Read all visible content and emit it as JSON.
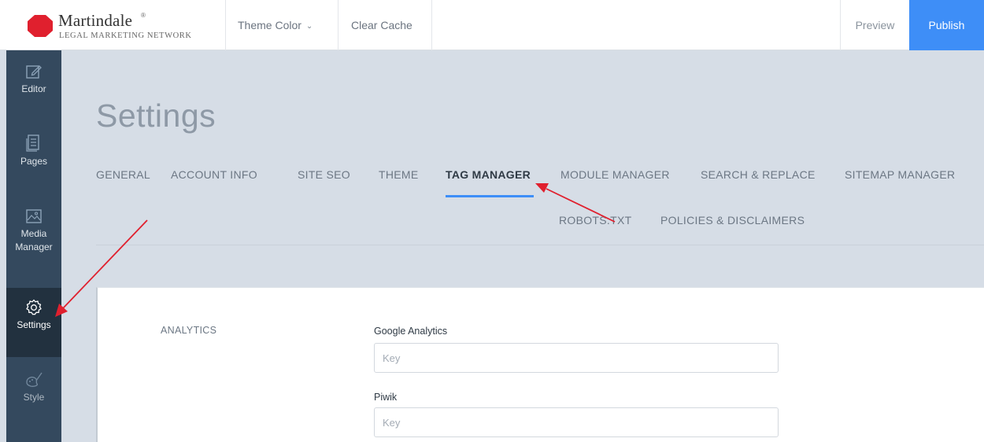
{
  "brand": {
    "name": "Martindale",
    "registered": "®",
    "tagline": "LEGAL MARKETING NETWORK"
  },
  "topbar": {
    "theme_color_label": "Theme Color",
    "clear_cache_label": "Clear Cache",
    "preview_label": "Preview",
    "publish_label": "Publish"
  },
  "sidebar": {
    "items": [
      {
        "label": "Editor",
        "icon": "edit-icon"
      },
      {
        "label": "Pages",
        "icon": "pages-icon"
      },
      {
        "label": "Media",
        "label2": "Manager",
        "icon": "image-icon"
      },
      {
        "label": "Settings",
        "icon": "gear-icon",
        "active": true
      },
      {
        "label": "Style",
        "icon": "palette-icon"
      }
    ]
  },
  "page": {
    "title": "Settings"
  },
  "tabs": [
    {
      "label": "GENERAL"
    },
    {
      "label": "ACCOUNT INFO"
    },
    {
      "label": "SITE SEO"
    },
    {
      "label": "THEME"
    },
    {
      "label": "TAG MANAGER",
      "active": true
    },
    {
      "label": "MODULE MANAGER"
    },
    {
      "label": "SEARCH & REPLACE"
    },
    {
      "label": "SITEMAP MANAGER"
    },
    {
      "label": "ROBOTS.TXT"
    },
    {
      "label": "POLICIES & DISCLAIMERS"
    }
  ],
  "analytics": {
    "section_label": "ANALYTICS",
    "google_label": "Google Analytics",
    "google_placeholder": "Key",
    "piwik_label": "Piwik",
    "piwik_placeholder": "Key"
  },
  "colors": {
    "accent": "#3e8ef7",
    "sidebar": "#34495e",
    "sidebar_active": "#22313f",
    "brand_red": "#e0202e",
    "annotation_arrow": "#e0202e"
  }
}
